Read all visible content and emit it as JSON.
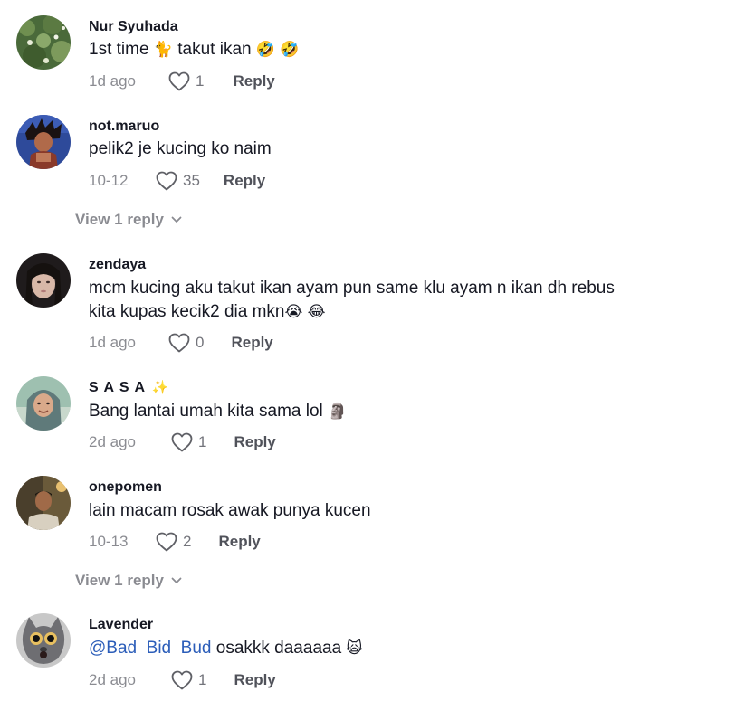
{
  "comments": [
    {
      "username": "Nur Syuhada",
      "text_a": "1st time ",
      "emoji_cat": "🐈",
      "text_b": " takut ikan ",
      "emoji_laugh1": "🤣",
      "emoji_laugh2": "🤣",
      "date": "1d ago",
      "likes": "1",
      "reply": "Reply"
    },
    {
      "username": "not.maruo",
      "text": "pelik2 je kucing ko naim",
      "date": "10-12",
      "likes": "35",
      "reply": "Reply",
      "view_replies": "View 1 reply"
    },
    {
      "username": "zendaya",
      "text_line1": "mcm kucing aku takut ikan ayam pun same klu ayam n ikan dh rebus",
      "text_line2": "kita kupas kecik2 dia mkn",
      "emoji_cry": "😭",
      "emoji_joy": "😂",
      "date": "1d ago",
      "likes": "0",
      "reply": "Reply"
    },
    {
      "username": "S A S A",
      "username_emoji": "✨",
      "text": "Bang lantai umah kita sama lol ",
      "emoji_moai": "🗿",
      "date": "2d ago",
      "likes": "1",
      "reply": "Reply"
    },
    {
      "username": "onepomen",
      "text": "lain macam rosak awak punya kucen",
      "date": "10-13",
      "likes": "2",
      "reply": "Reply",
      "view_replies": "View 1 reply"
    },
    {
      "username": "Lavender",
      "mention": "@Bad  Bid  Bud",
      "text": " osakkk daaaaaa ",
      "emoji_scream_cat": "🙀",
      "date": "2d ago",
      "likes": "1",
      "reply": "Reply"
    }
  ],
  "icons": {
    "like": "heart-outline-icon",
    "expand": "chevron-down-icon"
  },
  "colors": {
    "text": "#161823",
    "secondary": "#8a8b91",
    "mention": "#2b5db9"
  }
}
